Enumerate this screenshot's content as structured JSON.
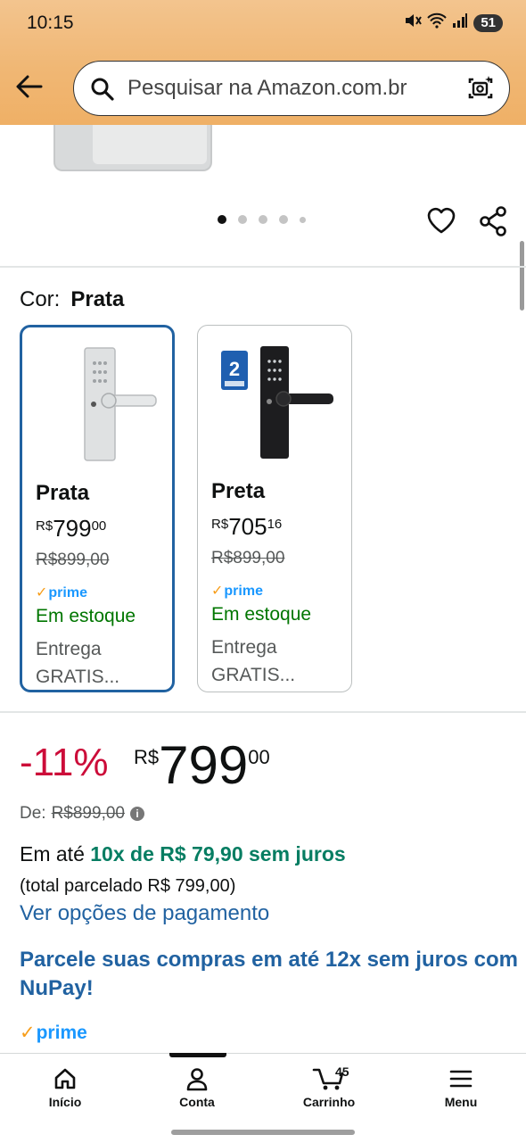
{
  "status_bar": {
    "time": "10:15",
    "battery": "51"
  },
  "search": {
    "placeholder": "Pesquisar na Amazon.com.br"
  },
  "color_selector": {
    "label": "Cor:",
    "selected": "Prata",
    "options": [
      {
        "name": "Prata",
        "currency": "R$",
        "whole": "799",
        "fraction": "00",
        "old_price": "R$899,00",
        "prime": "prime",
        "stock": "Em estoque",
        "shipping": "Entrega GRATIS..."
      },
      {
        "name": "Preta",
        "currency": "R$",
        "whole": "705",
        "fraction": "16",
        "old_price": "R$899,00",
        "prime": "prime",
        "stock": "Em estoque",
        "shipping": "Entrega GRATIS..."
      }
    ]
  },
  "price": {
    "discount": "-11%",
    "currency": "R$",
    "whole": "799",
    "fraction": "00",
    "de_label": "De:",
    "old_price": "R$899,00",
    "installment_prefix": "Em até",
    "installment_highlight": "10x de R$ 79,90 sem juros",
    "total": "(total parcelado R$ 799,00)",
    "payment_options_link": "Ver opções de pagamento",
    "nupay_promo": "Parcele suas compras em até 12x sem juros com NuPay!",
    "prime": "prime"
  },
  "bottom_nav": {
    "items": [
      {
        "label": "Início"
      },
      {
        "label": "Conta"
      },
      {
        "label": "Carrinho",
        "count": "45"
      },
      {
        "label": "Menu"
      }
    ]
  },
  "colors": {
    "link": "#2162a1",
    "discount": "#cc0c39",
    "stock": "#007600",
    "prime": "#1a98ff",
    "header": "#f0b774"
  }
}
